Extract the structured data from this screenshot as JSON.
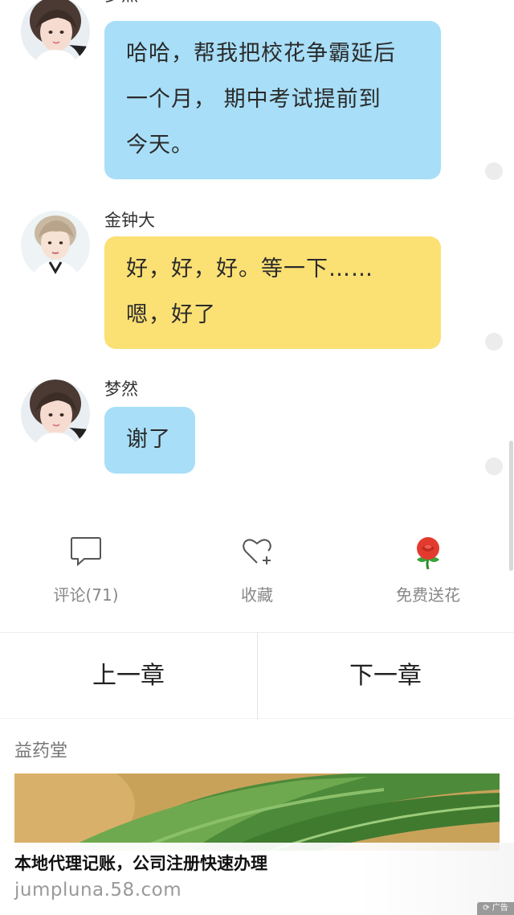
{
  "messages": [
    {
      "sender": "梦然",
      "lines": [
        "哈哈，帮我把校花争霸延后",
        "一个月， 期中考试提前到",
        "今天。"
      ],
      "bubble_color": "#a8def7",
      "avatar": "girl-avatar"
    },
    {
      "sender": "金钟大",
      "lines": [
        "好，好，好。等一下……",
        "嗯，好了"
      ],
      "bubble_color": "#fbe074",
      "avatar": "boy-avatar"
    },
    {
      "sender": "梦然",
      "lines": [
        "谢了"
      ],
      "bubble_color": "#a8def7",
      "avatar": "girl-avatar"
    }
  ],
  "actions": {
    "comment_label": "评论(71)",
    "favorite_label": "收藏",
    "flower_label": "免费送花"
  },
  "chapter_nav": {
    "prev_label": "上一章",
    "next_label": "下一章"
  },
  "ad": {
    "source": "益药堂",
    "title": "本地代理记账，公司注册快速办理",
    "url": "jumpluna.58.com",
    "tag": "⟳ 广告"
  },
  "icons": {
    "comment": "speech-bubble-icon",
    "favorite": "heart-plus-icon",
    "flower": "rose-icon"
  }
}
